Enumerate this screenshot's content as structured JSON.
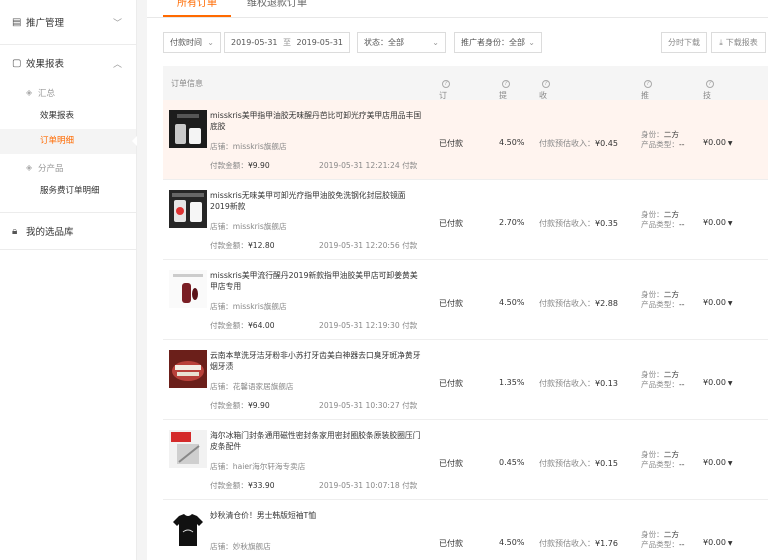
{
  "sidebar": {
    "groups": [
      {
        "label": "推广管理",
        "icon": "promotion-icon"
      },
      {
        "label": "效果报表",
        "icon": "report-icon"
      },
      {
        "label": "我的选品库",
        "icon": "lock-icon"
      }
    ],
    "report_sections": [
      {
        "label": "汇总"
      },
      {
        "label": "分产品"
      }
    ],
    "report_items": [
      "效果报表",
      "订单明细",
      "服务费订单明细"
    ]
  },
  "tabs": [
    "所有订单",
    "维权退款订单"
  ],
  "filters": {
    "time_type": "付款时间",
    "date_from": "2019-05-31",
    "date_sep": "至",
    "date_to": "2019-05-31",
    "status": "状态：全部",
    "role": "推广者身份：全部"
  },
  "buttons": {
    "split_download": "分时下载",
    "download_report": "下载报表"
  },
  "columns": {
    "info": "订单信息",
    "status": "订单状态",
    "rate": "提成",
    "income": "收入",
    "promoter": "推广者",
    "fee": "技术服务费"
  },
  "labels": {
    "shop_prefix": "店铺：",
    "amount_prefix": "付款金额：",
    "est_income_prefix": "付款预估收入：",
    "role_prefix": "身份：",
    "ptype_prefix": "产品类型：",
    "paid_suffix": "付款"
  },
  "rows": [
    {
      "title": "misskris美甲指甲油胶无味醒丹芭比可卸光疗美甲店用品丰国底胶",
      "shop": "misskris旗舰店",
      "amount": "¥9.90",
      "time": "2019-05-31 12:21:24",
      "status": "已付款",
      "rate": "4.50%",
      "income": "¥0.45",
      "role": "二方",
      "ptype": "--",
      "fee": "¥0.00"
    },
    {
      "title": "misskris无味美甲可卸光疗指甲油胶免洗钢化封层胶镜面2019新款",
      "shop": "misskris旗舰店",
      "amount": "¥12.80",
      "time": "2019-05-31 12:20:56",
      "status": "已付款",
      "rate": "2.70%",
      "income": "¥0.35",
      "role": "二方",
      "ptype": "--",
      "fee": "¥0.00"
    },
    {
      "title": "misskris美甲流行醒丹2019新款指甲油胶美甲店可卸姜黄美甲店专用",
      "shop": "misskris旗舰店",
      "amount": "¥64.00",
      "time": "2019-05-31 12:19:30",
      "status": "已付款",
      "rate": "4.50%",
      "income": "¥2.88",
      "role": "二方",
      "ptype": "--",
      "fee": "¥0.00"
    },
    {
      "title": "云南本草洗牙洁牙粉非小苏打牙齿美白神器去口臭牙斑净黄牙烟牙渍",
      "shop": "花馨语家居旗舰店",
      "amount": "¥9.90",
      "time": "2019-05-31 10:30:27",
      "status": "已付款",
      "rate": "1.35%",
      "income": "¥0.13",
      "role": "二方",
      "ptype": "--",
      "fee": "¥0.00"
    },
    {
      "title": "海尔冰箱门封条通用磁性密封条家用密封圈胶条原装胶圈压门皮条配件",
      "shop": "haier海尔轩海专卖店",
      "amount": "¥33.90",
      "time": "2019-05-31 10:07:18",
      "status": "已付款",
      "rate": "0.45%",
      "income": "¥0.15",
      "role": "二方",
      "ptype": "--",
      "fee": "¥0.00"
    },
    {
      "title": "妙秋清仓价！男士韩版短袖T恤",
      "shop": "妙秋旗舰店",
      "amount": "",
      "time": "",
      "status": "已付款",
      "rate": "4.50%",
      "income": "¥1.76",
      "role": "二方",
      "ptype": "--",
      "fee": "¥0.00"
    }
  ],
  "colors": {
    "accent": "#ff6a00",
    "highlight_row": "#fff4ef"
  }
}
